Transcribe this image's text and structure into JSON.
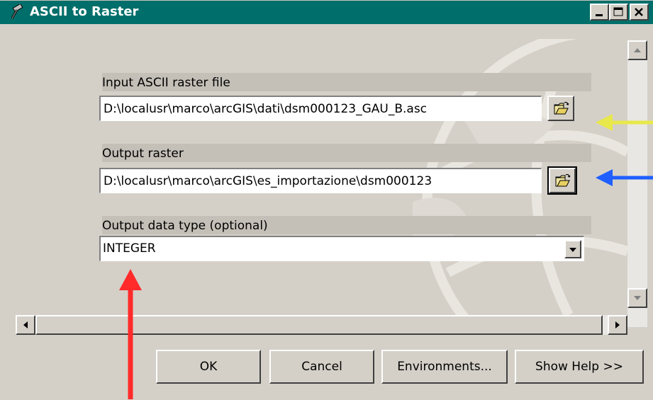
{
  "window": {
    "title": "ASCII to Raster"
  },
  "fields": {
    "input": {
      "label": "Input ASCII raster file",
      "value": "D:\\localusr\\marco\\arcGIS\\dati\\dsm000123_GAU_B.asc"
    },
    "output": {
      "label": "Output raster",
      "value": "D:\\localusr\\marco\\arcGIS\\es_importazione\\dsm000123"
    },
    "datatype": {
      "label": "Output data type (optional)",
      "value": "INTEGER"
    }
  },
  "buttons": {
    "ok": "OK",
    "cancel": "Cancel",
    "environments": "Environments...",
    "help": "Show Help >>"
  },
  "annotations": {
    "yellow_arrow_color": "#e8e84a",
    "blue_arrow_color": "#1f5fff",
    "red_arrow_color": "#ff2a2a"
  },
  "colors": {
    "titlebar": "#006e6a",
    "face": "#d4d0c8"
  }
}
